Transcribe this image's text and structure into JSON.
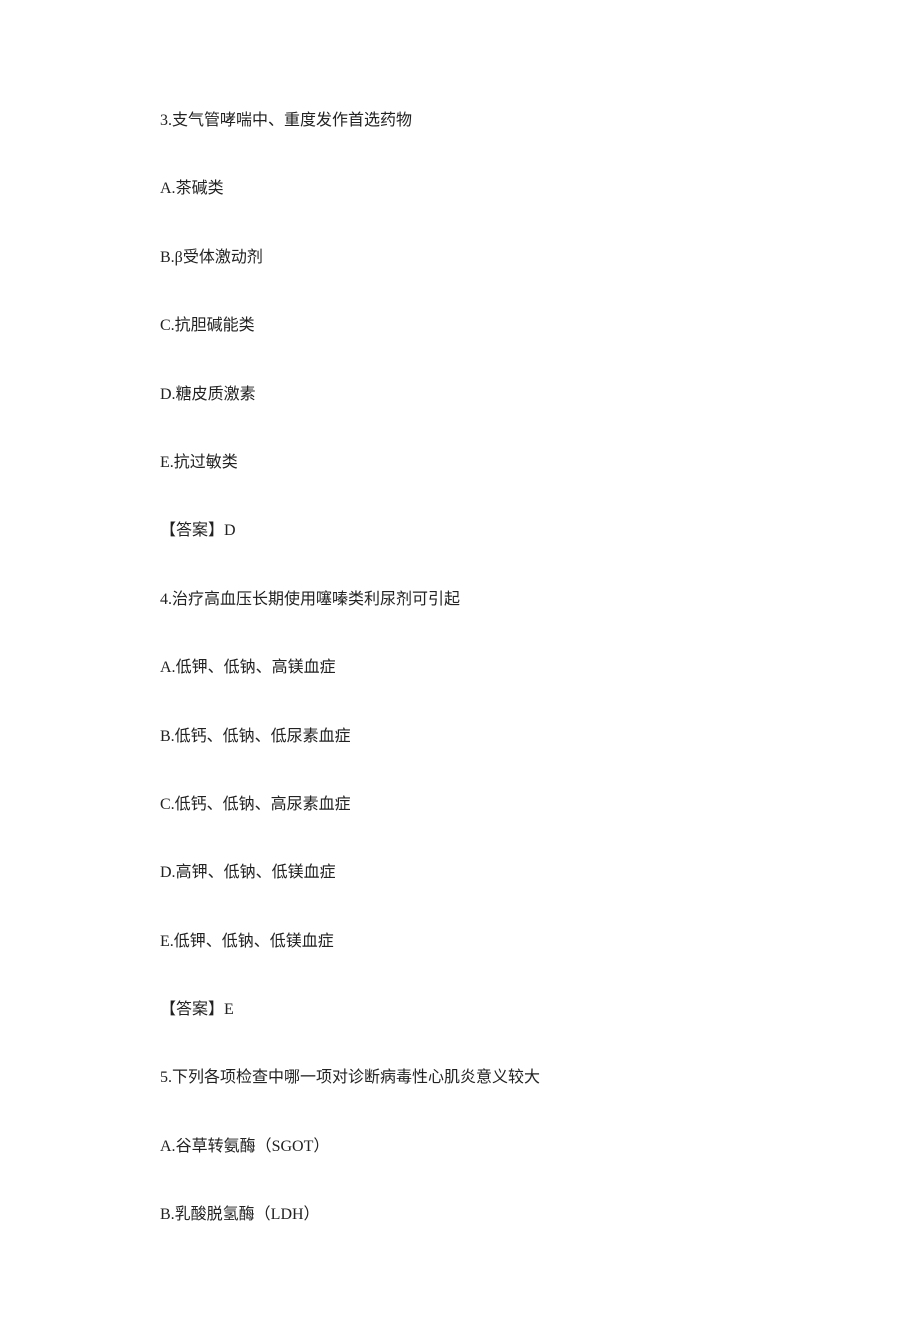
{
  "questions": [
    {
      "number": "3.",
      "stem": "支气管哮喘中、重度发作首选药物",
      "options": [
        {
          "label": "A.",
          "text": "茶碱类"
        },
        {
          "label": "B.",
          "text": "β受体激动剂"
        },
        {
          "label": "C.",
          "text": "抗胆碱能类"
        },
        {
          "label": "D.",
          "text": "糖皮质激素"
        },
        {
          "label": "E.",
          "text": "抗过敏类"
        }
      ],
      "answer_label": "【答案】",
      "answer_value": "D"
    },
    {
      "number": "4.",
      "stem": "治疗高血压长期使用噻嗪类利尿剂可引起",
      "options": [
        {
          "label": "A.",
          "text": "低钾、低钠、高镁血症"
        },
        {
          "label": "B.",
          "text": "低钙、低钠、低尿素血症"
        },
        {
          "label": "C.",
          "text": "低钙、低钠、高尿素血症"
        },
        {
          "label": "D.",
          "text": "高钾、低钠、低镁血症"
        },
        {
          "label": "E.",
          "text": "低钾、低钠、低镁血症"
        }
      ],
      "answer_label": "【答案】",
      "answer_value": "E"
    },
    {
      "number": "5.",
      "stem": "下列各项检查中哪一项对诊断病毒性心肌炎意义较大",
      "options": [
        {
          "label": "A.",
          "text": "谷草转氨酶（SGOT）"
        },
        {
          "label": "B.",
          "text": "乳酸脱氢酶（LDH）"
        }
      ],
      "answer_label": "",
      "answer_value": ""
    }
  ]
}
